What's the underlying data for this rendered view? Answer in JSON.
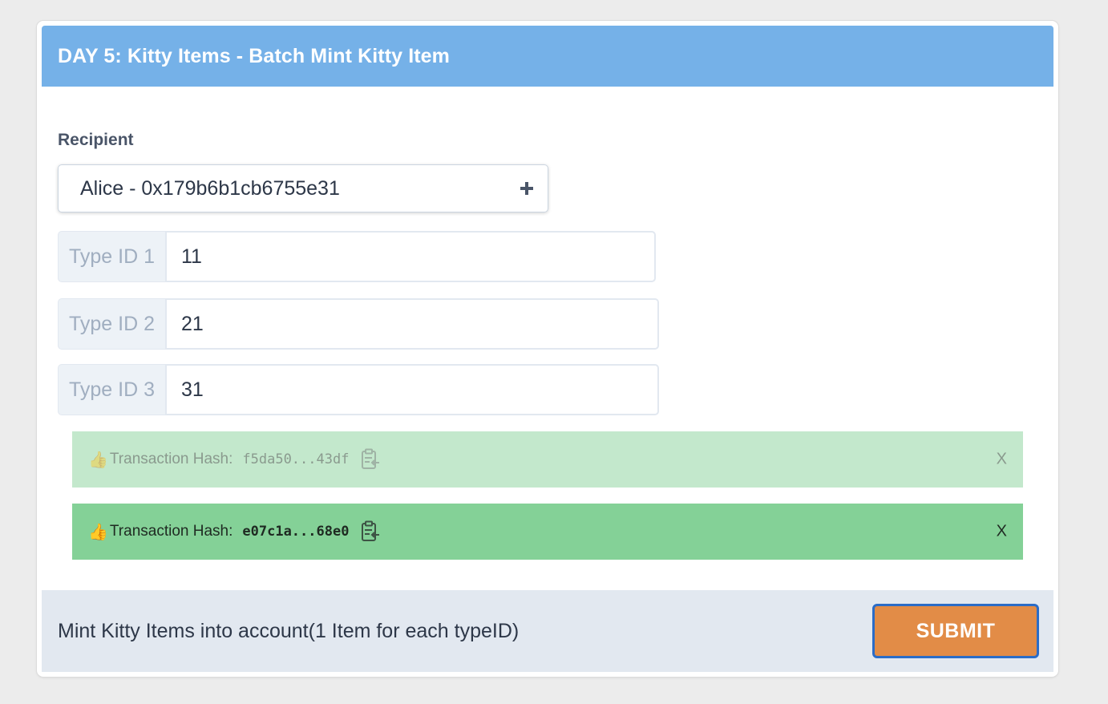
{
  "header": {
    "title": "DAY 5: Kitty Items - Batch Mint Kitty Item"
  },
  "form": {
    "recipient_label": "Recipient",
    "recipient_value": "Alice - 0x179b6b1cb6755e31",
    "recipient_icon": "plus-icon",
    "type_fields": [
      {
        "label": "Type ID 1",
        "value": "11"
      },
      {
        "label": "Type ID 2",
        "value": "21"
      },
      {
        "label": "Type ID 3",
        "value": "31"
      }
    ]
  },
  "alerts": [
    {
      "label": "Transaction Hash:",
      "hash": "f5da50...43df",
      "close": "X",
      "icon": "thumbs-up-icon",
      "copy_icon": "clipboard-icon",
      "state": "faded"
    },
    {
      "label": "Transaction Hash:",
      "hash": "e07c1a...68e0",
      "close": "X",
      "icon": "thumbs-up-icon",
      "copy_icon": "clipboard-icon",
      "state": "active"
    }
  ],
  "footer": {
    "description": "Mint Kitty Items into account(1 Item for each typeID)",
    "submit_label": "SUBMIT"
  },
  "colors": {
    "header_bg": "#75b1e8",
    "alert_faded_bg": "#c3e8cc",
    "alert_active_bg": "#84d197",
    "footer_bg": "#e2e8f0",
    "submit_bg": "#e28c47",
    "submit_border": "#2b6cc7"
  }
}
